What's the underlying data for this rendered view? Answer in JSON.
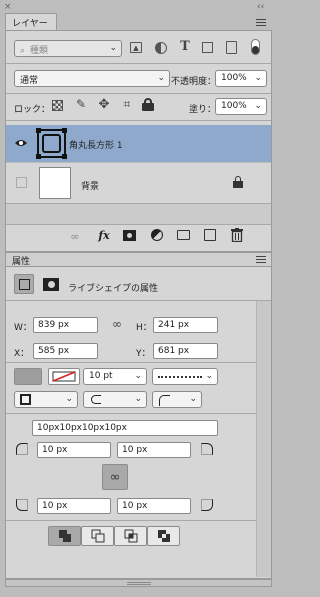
{
  "layers_panel": {
    "tab_label": "レイヤー",
    "filter_kind_placeholder": "種類",
    "blend_mode": "通常",
    "opacity_label": "不透明度：",
    "opacity_value": "100%",
    "lock_label": "ロック：",
    "fill_label": "塗り：",
    "fill_value": "100%",
    "layers": [
      {
        "name": "角丸長方形 1",
        "selected": true,
        "visible": true,
        "thumb": "shape"
      },
      {
        "name": "背景",
        "selected": false,
        "visible": false,
        "thumb": "white",
        "locked": true
      }
    ]
  },
  "properties_panel": {
    "tab_label": "属性",
    "title": "ライブシェイプの属性",
    "w_label": "W：",
    "w_value": "839 px",
    "h_label": "H：",
    "h_value": "241 px",
    "x_label": "X：",
    "x_value": "585 px",
    "y_label": "Y：",
    "y_value": "681 px",
    "stroke_width": "10 pt",
    "corner_radii_summary": "10px10px10px10px",
    "corner_tl": "10 px",
    "corner_tr": "10 px",
    "corner_bl": "10 px",
    "corner_br": "10 px"
  },
  "colors": {
    "selected_row": "#8fa9cd",
    "panel_bg": "#d6d6d6",
    "app_bg": "#bdbdbd"
  }
}
